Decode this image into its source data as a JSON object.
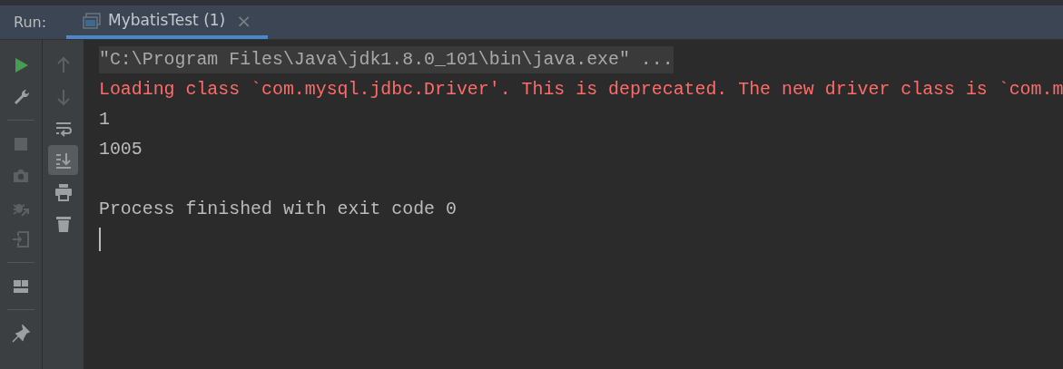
{
  "run_label": "Run:",
  "tabs": [
    {
      "label": "MybatisTest (1)",
      "close": "×",
      "selected": true
    }
  ],
  "left_toolbar": [
    {
      "kind": "run",
      "disabled": false
    },
    {
      "kind": "wrench",
      "disabled": false
    },
    {
      "kind": "divider"
    },
    {
      "kind": "stop",
      "disabled": true
    },
    {
      "kind": "camera",
      "disabled": true
    },
    {
      "kind": "bug",
      "disabled": true
    },
    {
      "kind": "exit",
      "disabled": true
    },
    {
      "kind": "divider"
    },
    {
      "kind": "layout",
      "disabled": false
    },
    {
      "kind": "divider"
    },
    {
      "kind": "pin",
      "disabled": false
    }
  ],
  "console_toolbar": [
    {
      "kind": "up",
      "disabled": true,
      "selected": false
    },
    {
      "kind": "down",
      "disabled": true,
      "selected": false
    },
    {
      "kind": "wrap",
      "disabled": false,
      "selected": false
    },
    {
      "kind": "scroll",
      "disabled": false,
      "selected": true
    },
    {
      "kind": "print",
      "disabled": false,
      "selected": false
    },
    {
      "kind": "trash",
      "disabled": false,
      "selected": false
    }
  ],
  "console": [
    {
      "kind": "command",
      "text": "\"C:\\Program Files\\Java\\jdk1.8.0_101\\bin\\java.exe\" ..."
    },
    {
      "kind": "error",
      "text": "Loading class `com.mysql.jdbc.Driver'. This is deprecated. The new driver class is `com.m"
    },
    {
      "kind": "output",
      "text": "1"
    },
    {
      "kind": "output",
      "text": "1005"
    },
    {
      "kind": "blank"
    },
    {
      "kind": "output",
      "text": "Process finished with exit code 0"
    },
    {
      "kind": "cursor"
    }
  ]
}
